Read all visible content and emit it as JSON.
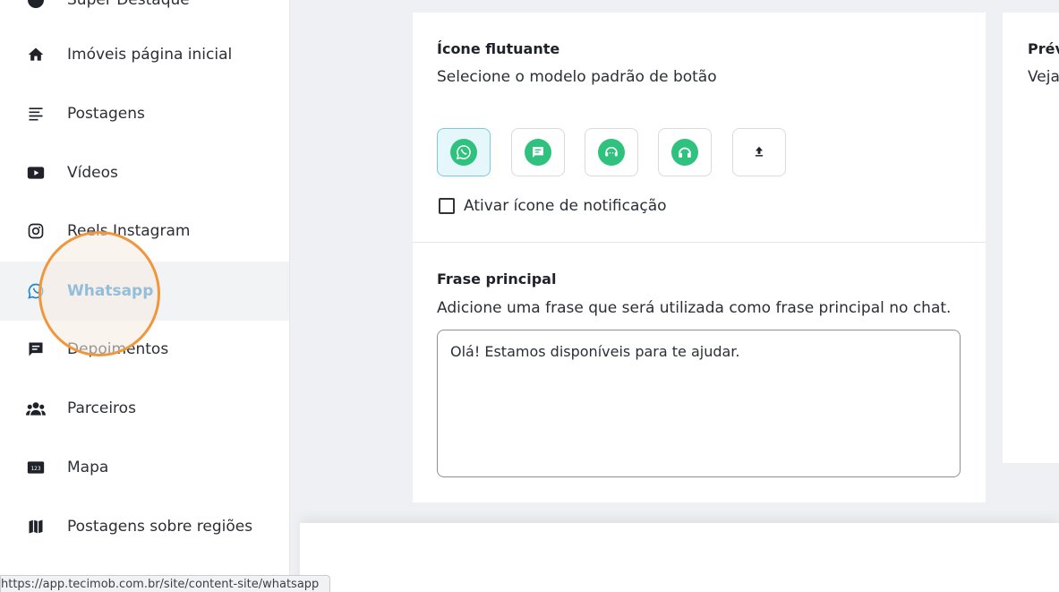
{
  "sidebar": {
    "items": [
      {
        "label": "Super Destaque",
        "icon": "super-destaque-icon"
      },
      {
        "label": "Imóveis página inicial",
        "icon": "home-icon"
      },
      {
        "label": "Postagens",
        "icon": "article-lines-icon"
      },
      {
        "label": "Vídeos",
        "icon": "youtube-icon"
      },
      {
        "label": "Reels Instagram",
        "icon": "instagram-icon"
      },
      {
        "label": "Whatsapp",
        "icon": "whatsapp-icon",
        "active": true
      },
      {
        "label": "Depoimentos",
        "icon": "chat-bubble-icon"
      },
      {
        "label": "Parceiros",
        "icon": "group-icon"
      },
      {
        "label": "Mapa",
        "icon": "numbers-123-icon"
      },
      {
        "label": "Postagens sobre regiões",
        "icon": "map-icon"
      }
    ]
  },
  "floating_icon": {
    "title": "Ícone flutuante",
    "description": "Selecione o modelo padrão de botão",
    "options": [
      "whatsapp-icon",
      "chat-bubble-icon",
      "support-agent-icon",
      "headset-icon",
      "upload-icon"
    ],
    "selected_index": 0,
    "notification_checkbox_label": "Ativar ícone de notificação",
    "notification_checked": false
  },
  "main_phrase": {
    "title": "Frase principal",
    "description": "Adicione uma frase que será utilizada como frase principal no chat.",
    "value": "Olá! Estamos disponíveis para te ajudar."
  },
  "preview": {
    "title": "Prév",
    "subtitle": "Veja"
  },
  "status_bar": {
    "url": "https://app.tecimob.com.br/site/content-site/whatsapp"
  },
  "colors": {
    "accent": "#1a87d0",
    "icon_green": "#2ec27e",
    "highlight": "#f0963c"
  }
}
